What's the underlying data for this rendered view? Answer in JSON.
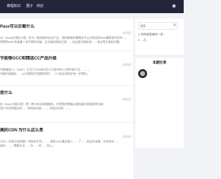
{
  "nav": {
    "items": [
      "教程知识",
      "圈子",
      "商店"
    ],
    "user_icon": "user-icon"
  },
  "articles": [
    {
      "title": "Pass可以拦截什么",
      "date": "5月5日",
      "text": [
        "AF（Web应用防火墙）作为一款成熟的安全产品，其所能做的事情远不止对常见的Web漏洞进行防护，。",
        "免费的WAF也具备一些不错的功能，全天候的网站已经……在这里详细讲述……攻击等方面的问题。"
      ]
    },
    {
      "title": "节能够GCC和精选CC产品升级",
      "date": "5月5日",
      "text": [
        "节能服务CC（WAF）正式于2025年5月21日发布的CC防护新产品，……。",
        "节能升级服务……以方便防护范围的同时……CC攻击的防护进一步提升。"
      ]
    },
    {
      "title": "是什么",
      "date": "5月5日",
      "text": [
        "务（Web 内容分发）是一种分布式网络服务，它将您的数据从服务器内容复制到全球，",
        "用户访问到更近的……的网站内容……，实现访问的……。"
      ]
    },
    {
      "title": "高防CDN 为什么这么贵",
      "date": "5月5日",
      "text": [
        "CDN（内容分发网络）则有所不同，……高防CDN通过接入……了……攻击的流量，它的成本……",
        "成本……，需要企业……为……的……投入。"
      ]
    }
  ],
  "sidebar": {
    "search_placeholder": "搜索",
    "notices": [
      "你的收获者的一些...",
      "...之..."
    ],
    "author_section": {
      "heading": "本期分享",
      "name": "…",
      "info": "…"
    }
  }
}
